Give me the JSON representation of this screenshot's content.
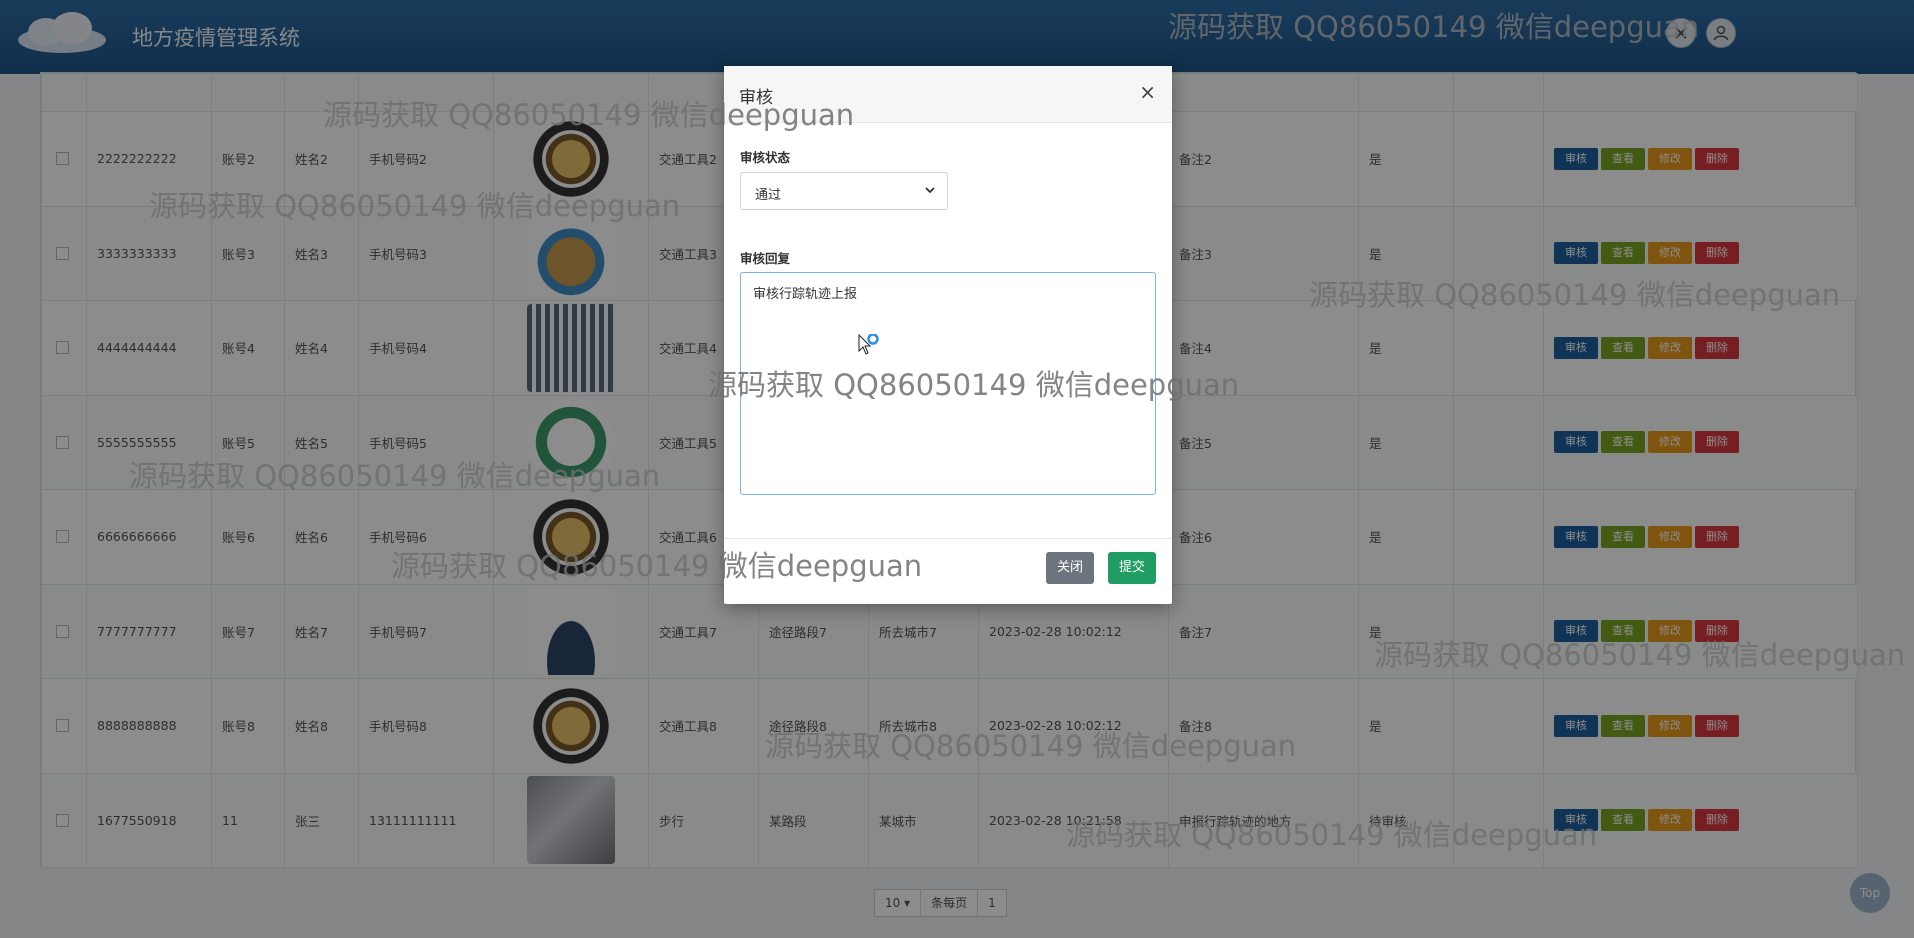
{
  "app": {
    "title": "地方疫情管理系统"
  },
  "header_icons": [
    "exit-icon",
    "user-icon"
  ],
  "table": {
    "rows": [
      {
        "id": "2222222222",
        "account": "账号2",
        "name": "姓名2",
        "phone": "手机号码2",
        "image": "round",
        "transport": "交通工具2",
        "route": "",
        "city": "",
        "time": "",
        "remark": "备注2",
        "flag": "是"
      },
      {
        "id": "3333333333",
        "account": "账号3",
        "name": "姓名3",
        "phone": "手机号码3",
        "image": "cake",
        "transport": "交通工具3",
        "route": "",
        "city": "",
        "time": "",
        "remark": "备注3",
        "flag": "是"
      },
      {
        "id": "4444444444",
        "account": "账号4",
        "name": "姓名4",
        "phone": "手机号码4",
        "image": "qr",
        "transport": "交通工具4",
        "route": "",
        "city": "",
        "time": "",
        "remark": "备注4",
        "flag": "是"
      },
      {
        "id": "5555555555",
        "account": "账号5",
        "name": "姓名5",
        "phone": "手机号码5",
        "image": "green",
        "transport": "交通工具5",
        "route": "",
        "city": "",
        "time": "",
        "remark": "备注5",
        "flag": "是"
      },
      {
        "id": "6666666666",
        "account": "账号6",
        "name": "姓名6",
        "phone": "手机号码6",
        "image": "round",
        "transport": "交通工具6",
        "route": "",
        "city": "",
        "time": "",
        "remark": "备注6",
        "flag": "是"
      },
      {
        "id": "7777777777",
        "account": "账号7",
        "name": "姓名7",
        "phone": "手机号码7",
        "image": "phone",
        "transport": "交通工具7",
        "route": "途径路段7",
        "city": "所去城市7",
        "time": "2023-02-28 10:02:12",
        "remark": "备注7",
        "flag": "是"
      },
      {
        "id": "8888888888",
        "account": "账号8",
        "name": "姓名8",
        "phone": "手机号码8",
        "image": "round",
        "transport": "交通工具8",
        "route": "途径路段8",
        "city": "所去城市8",
        "time": "2023-02-28 10:02:12",
        "remark": "备注8",
        "flag": "是"
      },
      {
        "id": "1677550918",
        "account": "11",
        "name": "张三",
        "phone": "13111111111",
        "image": "photo",
        "transport": "步行",
        "route": "某路段",
        "city": "某城市",
        "time": "2023-02-28 10:21:58",
        "remark": "申报行踪轨迹的地方",
        "flag": "待审核"
      }
    ],
    "actions": {
      "review": "审核",
      "view": "查看",
      "edit": "修改",
      "delete": "删除"
    }
  },
  "pager": {
    "page_size": "10",
    "per_page_label": "条每页",
    "page": "1"
  },
  "top_button": "Top",
  "modal": {
    "title": "审核",
    "close_icon": "×",
    "status_label": "审核状态",
    "status_value": "通过",
    "reply_label": "审核回复",
    "reply_value": "审核行踪轨迹上报",
    "close_button": "关闭",
    "submit_button": "提交"
  },
  "watermark": "源码获取 QQ86050149 微信deepguan"
}
